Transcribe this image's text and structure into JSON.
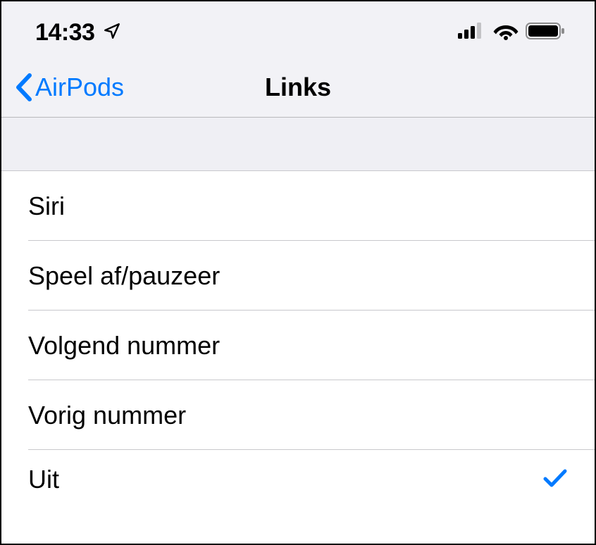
{
  "status_bar": {
    "time": "14:33"
  },
  "nav": {
    "back_label": "AirPods",
    "title": "Links"
  },
  "options": [
    {
      "label": "Siri",
      "selected": false
    },
    {
      "label": "Speel af/pauzeer",
      "selected": false
    },
    {
      "label": "Volgend nummer",
      "selected": false
    },
    {
      "label": "Vorig nummer",
      "selected": false
    },
    {
      "label": "Uit",
      "selected": true
    }
  ]
}
